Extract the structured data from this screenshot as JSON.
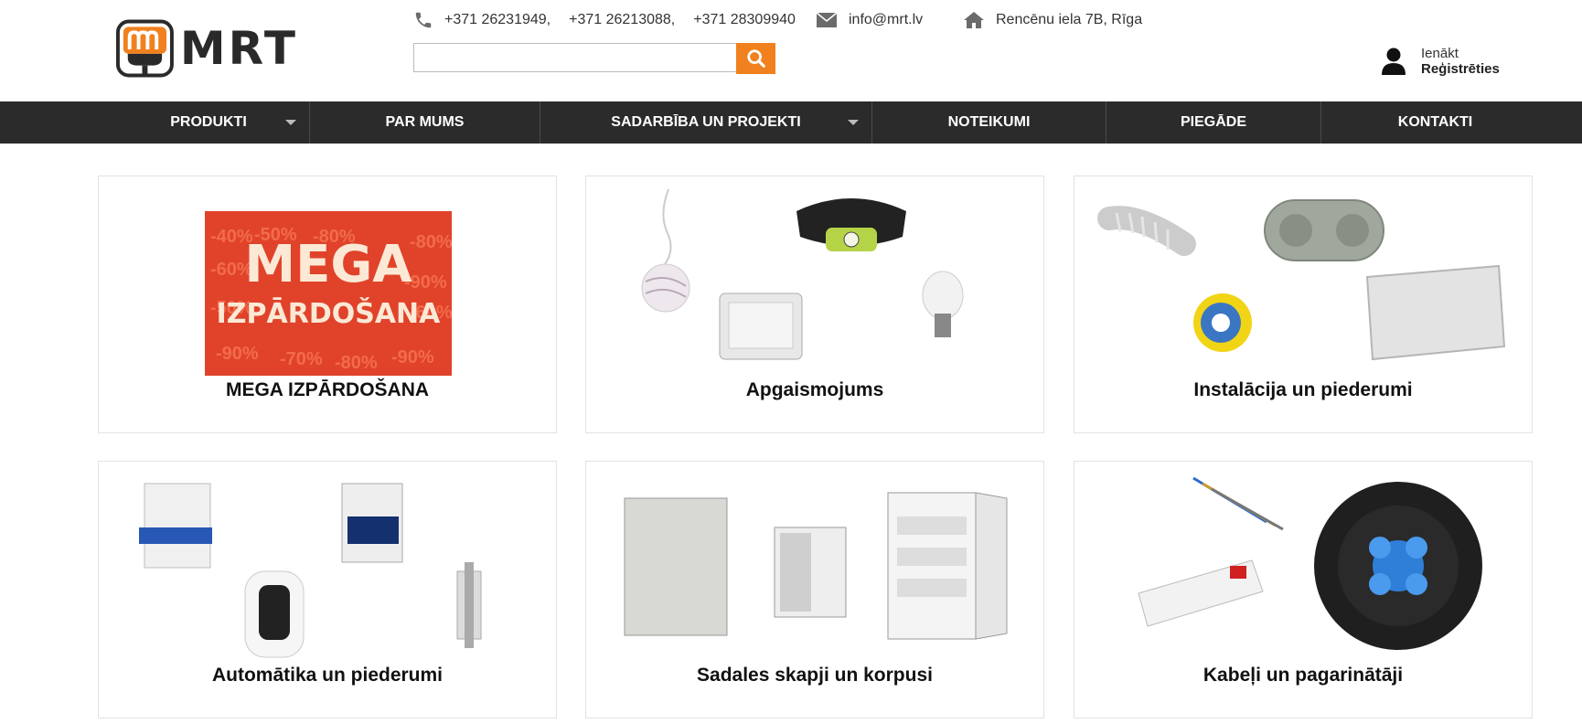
{
  "brand": {
    "name": "MRT",
    "accent": "#f0811e"
  },
  "contact": {
    "phones": [
      "+371 26231949,",
      "+371 26213088,",
      "+371 28309940"
    ],
    "email": "info@mrt.lv",
    "address": "Rencēnu iela 7B, Rīga"
  },
  "search": {
    "placeholder": "",
    "value": ""
  },
  "account": {
    "login": "Ienākt",
    "register": "Reģistrēties"
  },
  "nav": {
    "items": [
      {
        "label": "PRODUKTI",
        "dropdown": true
      },
      {
        "label": "PAR MUMS",
        "dropdown": false
      },
      {
        "label": "SADARBĪBA UN PROJEKTI",
        "dropdown": true
      },
      {
        "label": "NOTEIKUMI",
        "dropdown": false
      },
      {
        "label": "PIEGĀDE",
        "dropdown": false
      },
      {
        "label": "KONTAKTI",
        "dropdown": false
      }
    ]
  },
  "categories": [
    {
      "title": "MEGA IZPĀRDOŠANA",
      "banner": {
        "line1": "MEGA",
        "line2": "IZPĀRDOŠANA",
        "discounts": [
          "-40%",
          "-50%",
          "-80%",
          "-60%",
          "-90%",
          "-50%",
          "-60%",
          "-90%",
          "-70%",
          "-80%",
          "-90%",
          "-80%"
        ]
      }
    },
    {
      "title": "Apgaismojums"
    },
    {
      "title": "Instalācija un piederumi"
    },
    {
      "title": "Automātika un piederumi"
    },
    {
      "title": "Sadales skapji un korpusi"
    },
    {
      "title": "Kabeļi un pagarinātāji"
    }
  ],
  "icons": [
    "phone-icon",
    "mail-icon",
    "home-icon",
    "search-icon",
    "user-icon",
    "logo-plug-icon"
  ]
}
